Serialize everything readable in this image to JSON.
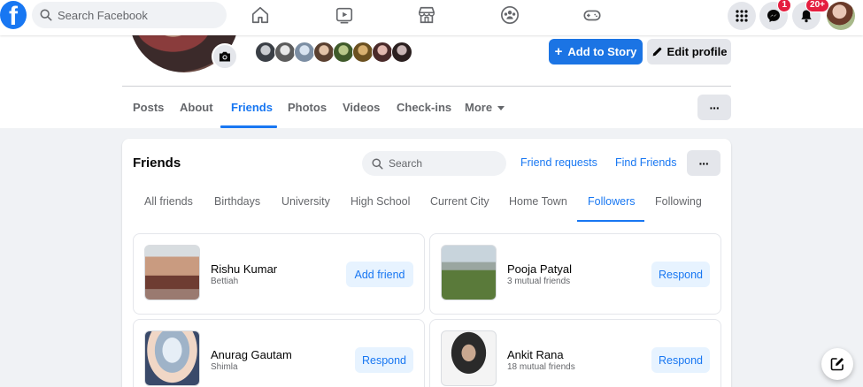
{
  "topnav": {
    "logo": "f",
    "search_placeholder": "Search Facebook",
    "messenger_badge": "1",
    "notifications_badge": "20+"
  },
  "profile": {
    "add_story_label": "Add to Story",
    "edit_profile_label": "Edit profile",
    "tabs": [
      "Posts",
      "About",
      "Friends",
      "Photos",
      "Videos",
      "Check-ins",
      "More"
    ],
    "more_dots": "···"
  },
  "friends": {
    "title": "Friends",
    "search_placeholder": "Search",
    "friend_requests_label": "Friend requests",
    "find_friends_label": "Find Friends",
    "dots": "···",
    "subtabs": [
      "All friends",
      "Birthdays",
      "University",
      "High School",
      "Current City",
      "Home Town",
      "Followers",
      "Following"
    ],
    "people": [
      {
        "name": "Rishu Kumar",
        "sub": "Bettiah",
        "button": "Add friend"
      },
      {
        "name": "Pooja Patyal",
        "sub": "3 mutual friends",
        "button": "Respond"
      },
      {
        "name": "Anurag Gautam",
        "sub": "Shimla",
        "button": "Respond"
      },
      {
        "name": "Ankit Rana",
        "sub": "18 mutual friends",
        "button": "Respond"
      }
    ]
  },
  "colors": {
    "accent": "#1877f2",
    "accent_light": "#e7f3ff",
    "badge": "#e41e3f"
  }
}
